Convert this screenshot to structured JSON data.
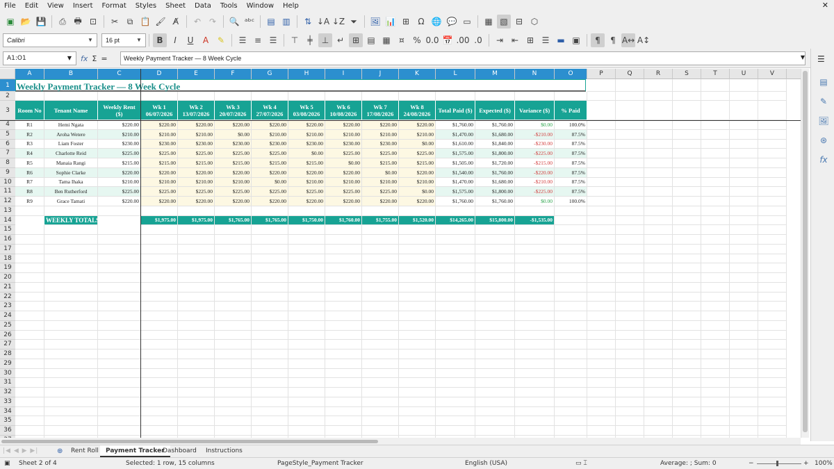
{
  "menu": [
    "File",
    "Edit",
    "View",
    "Insert",
    "Format",
    "Styles",
    "Sheet",
    "Data",
    "Tools",
    "Window",
    "Help"
  ],
  "format": {
    "font": "Calibri",
    "size": "16 pt"
  },
  "formula": {
    "namebox": "A1:O1",
    "content": "Weekly Payment Tracker — 8 Week Cycle"
  },
  "columns": [
    "A",
    "B",
    "C",
    "D",
    "E",
    "F",
    "G",
    "H",
    "I",
    "J",
    "K",
    "L",
    "M",
    "N",
    "O",
    "P",
    "Q",
    "R",
    "S",
    "T",
    "U",
    "V"
  ],
  "sheet": {
    "title": "Weekly Payment Tracker — 8 Week Cycle",
    "headers": [
      "Room No",
      "Tenant Name",
      "Weekly Rent ($)",
      "Wk 1 06/07/2026",
      "Wk 2 13/07/2026",
      "Wk 3 20/07/2026",
      "Wk 4 27/07/2026",
      "Wk 5 03/08/2026",
      "Wk 6 10/08/2026",
      "Wk 7 17/08/2026",
      "Wk 8 24/08/2026",
      "Total Paid ($)",
      "Expected ($)",
      "Variance ($)",
      "% Paid"
    ],
    "rows": [
      [
        "R1",
        "Hemi Ngata",
        "$220.00",
        "$220.00",
        "$220.00",
        "$220.00",
        "$220.00",
        "$220.00",
        "$220.00",
        "$220.00",
        "$220.00",
        "$1,760.00",
        "$1,760.00",
        "$0.00",
        "100.0%"
      ],
      [
        "R2",
        "Aroha Wetere",
        "$210.00",
        "$210.00",
        "$210.00",
        "$0.00",
        "$210.00",
        "$210.00",
        "$210.00",
        "$210.00",
        "$210.00",
        "$1,470.00",
        "$1,680.00",
        "-$210.00",
        "87.5%"
      ],
      [
        "R3",
        "Liam Foster",
        "$230.00",
        "$230.00",
        "$230.00",
        "$230.00",
        "$230.00",
        "$230.00",
        "$230.00",
        "$230.00",
        "$0.00",
        "$1,610.00",
        "$1,840.00",
        "-$230.00",
        "87.5%"
      ],
      [
        "R4",
        "Charlotte Reid",
        "$225.00",
        "$225.00",
        "$225.00",
        "$225.00",
        "$225.00",
        "$0.00",
        "$225.00",
        "$225.00",
        "$225.00",
        "$1,575.00",
        "$1,800.00",
        "-$225.00",
        "87.5%"
      ],
      [
        "R5",
        "Manaia Rangi",
        "$215.00",
        "$215.00",
        "$215.00",
        "$215.00",
        "$215.00",
        "$215.00",
        "$0.00",
        "$215.00",
        "$215.00",
        "$1,505.00",
        "$1,720.00",
        "-$215.00",
        "87.5%"
      ],
      [
        "R6",
        "Sophie Clarke",
        "$220.00",
        "$220.00",
        "$220.00",
        "$220.00",
        "$220.00",
        "$220.00",
        "$220.00",
        "$0.00",
        "$220.00",
        "$1,540.00",
        "$1,760.00",
        "-$220.00",
        "87.5%"
      ],
      [
        "R7",
        "Tama Ihaka",
        "$210.00",
        "$210.00",
        "$210.00",
        "$210.00",
        "$0.00",
        "$210.00",
        "$210.00",
        "$210.00",
        "$210.00",
        "$1,470.00",
        "$1,680.00",
        "-$210.00",
        "87.5%"
      ],
      [
        "R8",
        "Ben Rutherford",
        "$225.00",
        "$225.00",
        "$225.00",
        "$225.00",
        "$225.00",
        "$225.00",
        "$225.00",
        "$225.00",
        "$0.00",
        "$1,575.00",
        "$1,800.00",
        "-$225.00",
        "87.5%"
      ],
      [
        "R9",
        "Grace Tamati",
        "$220.00",
        "$220.00",
        "$220.00",
        "$220.00",
        "$220.00",
        "$220.00",
        "$220.00",
        "$220.00",
        "$220.00",
        "$1,760.00",
        "$1,760.00",
        "$0.00",
        "100.0%"
      ]
    ],
    "totals_label": "WEEKLY TOTALS",
    "totals": [
      "$1,975.00",
      "$1,975.00",
      "$1,765.00",
      "$1,765.00",
      "$1,750.00",
      "$1,760.00",
      "$1,755.00",
      "$1,520.00",
      "$14,265.00",
      "$15,800.00",
      "-$1,535.00"
    ]
  },
  "tabs": [
    "Rent Roll",
    "Payment Tracker",
    "Dashboard",
    "Instructions"
  ],
  "active_tab": 1,
  "status": {
    "sheet": "Sheet 2 of 4",
    "selected": "Selected: 1 row, 15 columns",
    "pagestyle": "PageStyle_Payment Tracker",
    "language": "English (USA)",
    "sum": "Average: ; Sum: 0",
    "zoom": "100%"
  },
  "colors": {
    "header": "#17a394",
    "week_bg": "#fdf8e3",
    "negative": "#d23b3b",
    "positive": "#2aa34a",
    "selection": "#2c8fcf"
  }
}
